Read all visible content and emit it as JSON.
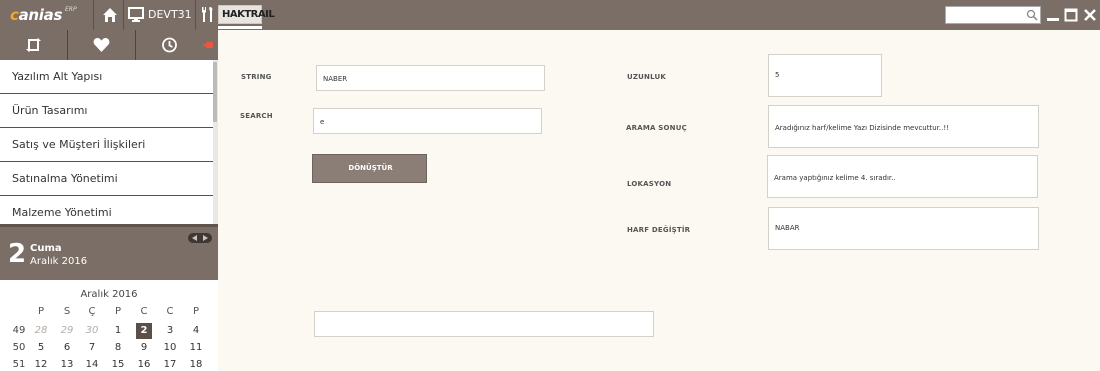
{
  "topbar": {
    "logo_text": "canias",
    "logo_sup": "ERP",
    "server_label": "DEVT31",
    "active_tab": "HAKTRAIL",
    "search_placeholder": ""
  },
  "sidebar": {
    "menu": [
      {
        "label": "Yazılım Alt Yapısı"
      },
      {
        "label": "Ürün Tasarımı"
      },
      {
        "label": "Satış ve Müşteri İlişkileri"
      },
      {
        "label": "Satınalma Yönetimi"
      },
      {
        "label": "Malzeme Yönetimi"
      }
    ],
    "date": {
      "day": "2",
      "day_name": "Cuma",
      "month_year": "Aralık 2016"
    },
    "calendar": {
      "title": "Aralık 2016",
      "weekday_headers": [
        "P",
        "S",
        "Ç",
        "P",
        "C",
        "C",
        "P"
      ],
      "weeks": [
        {
          "week": "49",
          "days": [
            "28",
            "29",
            "30",
            "1",
            "2",
            "3",
            "4"
          ]
        },
        {
          "week": "50",
          "days": [
            "5",
            "6",
            "7",
            "8",
            "9",
            "10",
            "11"
          ]
        },
        {
          "week": "51",
          "days": [
            "12",
            "13",
            "14",
            "15",
            "16",
            "17",
            "18"
          ]
        }
      ]
    }
  },
  "form": {
    "string_label": "STRING",
    "string_value": "NABER",
    "search_label": "SEARCH",
    "search_value": "e",
    "convert_button": "DÖNÜŞTÜR",
    "length_label": "UZUNLUK",
    "length_value": "5",
    "search_result_label": "ARAMA SONUÇ",
    "search_result_value": "Aradığınız harf/kelime Yazı Dizisinde mevcuttur..!!",
    "location_label": "LOKASYON",
    "location_value": "Arama yaptığınız kelime 4. sıradır..",
    "replace_label": "HARF DEĞİŞTİR",
    "replace_value": "NABAR",
    "bottom_value": ""
  },
  "colors": {
    "topbar": "#7a6e66",
    "accent": "#f5a623",
    "background": "#fbf9f2",
    "button": "#8a7e77"
  }
}
